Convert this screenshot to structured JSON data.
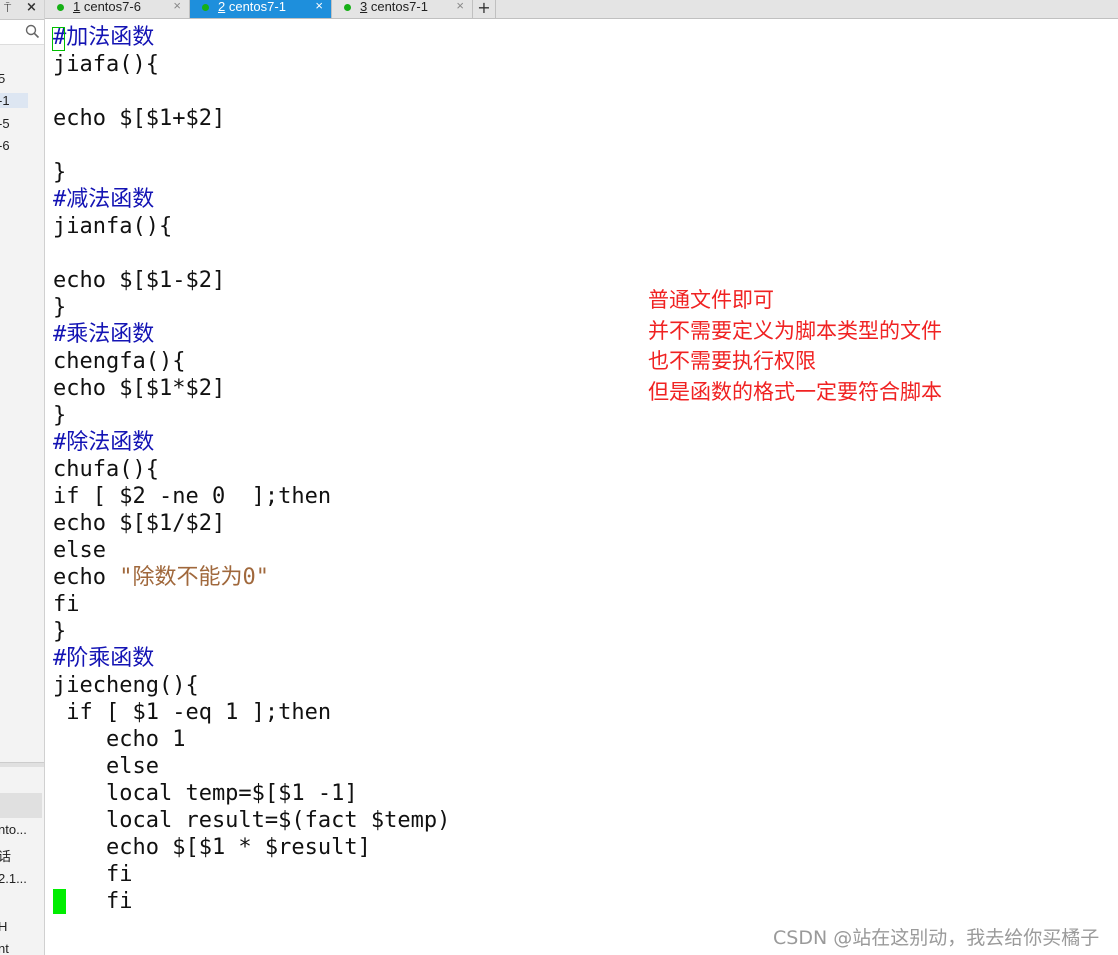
{
  "sidebar": {
    "pin_glyph": "⍑",
    "close_glyph": "×",
    "items": [
      "5",
      "-1",
      "-5",
      "-6"
    ],
    "bottom_items": [
      "nto...",
      "话",
      "2.1...",
      "H",
      "nt"
    ]
  },
  "tabs": [
    {
      "num": "1",
      "label": " centos7-6",
      "active": false
    },
    {
      "num": "2",
      "label": " centos7-1",
      "active": true
    },
    {
      "num": "3",
      "label": " centos7-1",
      "active": false
    }
  ],
  "add_tab": "+",
  "close_glyph": "×",
  "terminal": {
    "lines": [
      {
        "pre": "#",
        "rest": "加法函数",
        "cls": "cm",
        "cursor": true
      },
      {
        "text": "jiafa(){"
      },
      {
        "text": ""
      },
      {
        "text": "echo $[$1+$2]"
      },
      {
        "text": ""
      },
      {
        "text": "}"
      },
      {
        "text": "#减法函数",
        "cls": "cm"
      },
      {
        "text": "jianfa(){"
      },
      {
        "text": ""
      },
      {
        "text": "echo $[$1-$2]"
      },
      {
        "text": "}"
      },
      {
        "text": "#乘法函数",
        "cls": "cm"
      },
      {
        "text": "chengfa(){"
      },
      {
        "text": "echo $[$1*$2]"
      },
      {
        "text": "}"
      },
      {
        "text": "#除法函数",
        "cls": "cm"
      },
      {
        "text": "chufa(){"
      },
      {
        "text": "if [ $2 -ne 0  ];then"
      },
      {
        "text": "echo $[$1/$2]"
      },
      {
        "text": "else"
      },
      {
        "pre": "echo ",
        "rest": "\"除数不能为0\"",
        "cls": "str"
      },
      {
        "text": "fi"
      },
      {
        "text": "}"
      },
      {
        "text": "#阶乘函数",
        "cls": "cm"
      },
      {
        "text": "jiecheng(){"
      },
      {
        "text": " if [ $1 -eq 1 ];then"
      },
      {
        "text": "    echo 1"
      },
      {
        "text": "    else"
      },
      {
        "text": "    local temp=$[$1 -1]"
      },
      {
        "text": "    local result=$(fact $temp)"
      },
      {
        "text": "    echo $[$1 * $result]"
      },
      {
        "text": "    fi"
      },
      {
        "text": "    fi",
        "block_cursor": true
      }
    ]
  },
  "annotation": [
    "普通文件即可",
    "并不需要定义为脚本类型的文件",
    "也不需要执行权限",
    "但是函数的格式一定要符合脚本"
  ],
  "watermark": "CSDN @站在这别动，我去给你买橘子",
  "colors": {
    "comment": "#1414b4",
    "string": "#a0683c",
    "annotation": "#f02222",
    "active_tab": "#1e8fdc",
    "status_dot": "#16b016",
    "cursor": "#00ee00"
  },
  "icons": {
    "search": "search-icon",
    "status": "connected-dot-icon"
  }
}
